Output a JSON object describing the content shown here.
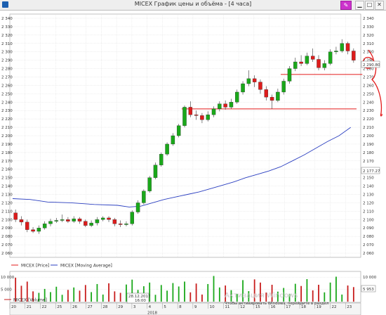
{
  "window": {
    "title": "MICEX График цены и объёма - [4 часа]",
    "pin_icon": "pin-icon"
  },
  "colors": {
    "bull": "#1aa81a",
    "bear": "#dd1c1c",
    "wick": "#333333",
    "ma": "#2b3fc0",
    "level": "#e31b1b",
    "annotation": "#e31b1b",
    "grid": "#d6d6d6",
    "volume_bar": "#1aa81a",
    "volume_bar_down": "#c81c1c"
  },
  "price_axis": {
    "ticks": [
      "2 060",
      "2 070",
      "2 080",
      "2 090",
      "2 100",
      "2 110",
      "2 120",
      "2 130",
      "2 140",
      "2 150",
      "2 160",
      "2 170",
      "2 180",
      "2 190",
      "2 200",
      "2 210",
      "2 220",
      "2 230",
      "2 240",
      "2 250",
      "2 260",
      "2 270",
      "2 280",
      "2 290",
      "2 300",
      "2 310",
      "2 320",
      "2 330",
      "2 340"
    ],
    "current_price_label": "2 290.80",
    "ma_label": "2 177.27"
  },
  "volume_axis": {
    "ticks": [
      "5 000",
      "10 000"
    ],
    "current_label": "5 953"
  },
  "legend": {
    "price": "MICEX [Price]",
    "ma": "MICEX [Moving Average]",
    "volume": "MICEX [Volume]"
  },
  "date_axis": {
    "labels": [
      "20",
      "21",
      "22",
      "25",
      "26",
      "27",
      "28",
      "29",
      "3",
      "4",
      "5",
      "8",
      "9",
      "10",
      "11",
      "12",
      "15",
      "16",
      "17",
      "18",
      "19",
      "22",
      "23"
    ],
    "cursor_label": "28.12.2017\n16:00",
    "year_label": "2018"
  },
  "watermark": {
    "line1": "Активация Windows",
    "line2": "Чтобы активировать Windows, перейдите в раздел"
  },
  "chart_data": {
    "type": "candlestick",
    "title": "MICEX График цены и объёма - [4 часа]",
    "ylim": [
      2055,
      2345
    ],
    "grid": true,
    "x": [
      "20",
      "21",
      "22",
      "25",
      "26",
      "27",
      "28",
      "29",
      "3",
      "4",
      "5",
      "8",
      "9",
      "10",
      "11",
      "12",
      "15",
      "16",
      "17",
      "18",
      "19",
      "22",
      "23"
    ],
    "candles": [
      [
        2108,
        2100,
        2112,
        2097
      ],
      [
        2100,
        2097,
        2104,
        2093
      ],
      [
        2097,
        2088,
        2100,
        2085
      ],
      [
        2088,
        2086,
        2091,
        2084
      ],
      [
        2086,
        2090,
        2093,
        2083
      ],
      [
        2090,
        2095,
        2098,
        2088
      ],
      [
        2095,
        2098,
        2101,
        2092
      ],
      [
        2098,
        2099,
        2102,
        2096
      ],
      [
        2099,
        2100,
        2106,
        2097
      ],
      [
        2100,
        2098,
        2103,
        2096
      ],
      [
        2098,
        2101,
        2104,
        2096
      ],
      [
        2101,
        2098,
        2103,
        2095
      ],
      [
        2098,
        2093,
        2100,
        2091
      ],
      [
        2093,
        2096,
        2099,
        2091
      ],
      [
        2096,
        2100,
        2103,
        2093
      ],
      [
        2100,
        2102,
        2104,
        2098
      ],
      [
        2102,
        2100,
        2104,
        2097
      ],
      [
        2100,
        2095,
        2102,
        2092
      ],
      [
        2095,
        2094,
        2099,
        2091
      ],
      [
        2094,
        2095,
        2098,
        2092
      ],
      [
        2095,
        2109,
        2111,
        2093
      ],
      [
        2109,
        2120,
        2123,
        2107
      ],
      [
        2120,
        2134,
        2136,
        2118
      ],
      [
        2134,
        2150,
        2152,
        2132
      ],
      [
        2150,
        2165,
        2168,
        2148
      ],
      [
        2165,
        2178,
        2180,
        2163
      ],
      [
        2178,
        2190,
        2192,
        2176
      ],
      [
        2190,
        2200,
        2203,
        2188
      ],
      [
        2200,
        2212,
        2214,
        2198
      ],
      [
        2212,
        2234,
        2236,
        2210
      ],
      [
        2234,
        2225,
        2241,
        2222
      ],
      [
        2225,
        2224,
        2230,
        2219
      ],
      [
        2224,
        2219,
        2227,
        2215
      ],
      [
        2219,
        2225,
        2229,
        2217
      ],
      [
        2225,
        2232,
        2235,
        2222
      ],
      [
        2232,
        2238,
        2241,
        2229
      ],
      [
        2238,
        2234,
        2242,
        2231
      ],
      [
        2234,
        2240,
        2244,
        2232
      ],
      [
        2240,
        2252,
        2255,
        2238
      ],
      [
        2252,
        2262,
        2265,
        2249
      ],
      [
        2262,
        2268,
        2278,
        2259
      ],
      [
        2268,
        2264,
        2272,
        2258
      ],
      [
        2264,
        2255,
        2267,
        2250
      ],
      [
        2255,
        2246,
        2259,
        2242
      ],
      [
        2246,
        2242,
        2249,
        2232
      ],
      [
        2242,
        2252,
        2256,
        2240
      ],
      [
        2252,
        2265,
        2268,
        2249
      ],
      [
        2265,
        2280,
        2283,
        2262
      ],
      [
        2280,
        2288,
        2293,
        2277
      ],
      [
        2288,
        2286,
        2296,
        2283
      ],
      [
        2286,
        2295,
        2299,
        2284
      ],
      [
        2295,
        2291,
        2304,
        2288
      ],
      [
        2291,
        2281,
        2296,
        2278
      ],
      [
        2281,
        2286,
        2290,
        2278
      ],
      [
        2286,
        2300,
        2303,
        2284
      ],
      [
        2300,
        2301,
        2306,
        2297
      ],
      [
        2301,
        2310,
        2315,
        2299
      ],
      [
        2310,
        2301,
        2312,
        2297
      ],
      [
        2301,
        2290,
        2304,
        2287
      ]
    ],
    "moving_average": {
      "name": "MICEX [Moving Average]",
      "points": [
        [
          0,
          2125
        ],
        [
          3,
          2124
        ],
        [
          6,
          2121
        ],
        [
          10,
          2120
        ],
        [
          14,
          2118
        ],
        [
          18,
          2117
        ],
        [
          20,
          2115
        ],
        [
          22,
          2116
        ],
        [
          24,
          2120
        ],
        [
          26,
          2124
        ],
        [
          28,
          2127
        ],
        [
          30,
          2130
        ],
        [
          32,
          2133
        ],
        [
          34,
          2137
        ],
        [
          36,
          2141
        ],
        [
          38,
          2145
        ],
        [
          40,
          2150
        ],
        [
          42,
          2154
        ],
        [
          44,
          2158
        ],
        [
          46,
          2163
        ],
        [
          48,
          2170
        ],
        [
          50,
          2177
        ],
        [
          52,
          2185
        ],
        [
          54,
          2193
        ],
        [
          56,
          2200
        ],
        [
          58,
          2210
        ]
      ]
    },
    "horizontal_levels": [
      {
        "value": 2232,
        "from": 29,
        "to": 58
      },
      {
        "value": 2273,
        "from": 46,
        "to": 59
      }
    ],
    "volume": [
      9800,
      6500,
      8200,
      4200,
      3600,
      5200,
      3900,
      6100,
      2800,
      4800,
      5800,
      4500,
      6800,
      3900,
      7200,
      2900,
      7500,
      4200,
      3600,
      7000,
      9000,
      4800,
      6300,
      7800,
      2800,
      6800,
      4500,
      7600,
      6200,
      8200,
      3800,
      7400,
      2900,
      7200,
      10500,
      5800,
      6600,
      4700,
      3200,
      8800,
      4300,
      9100,
      7800,
      3700,
      6900,
      4100,
      5600,
      3200,
      7300,
      6400,
      9200,
      4600,
      6900,
      3800,
      7800,
      10200,
      2900,
      6600,
      5953
    ]
  }
}
